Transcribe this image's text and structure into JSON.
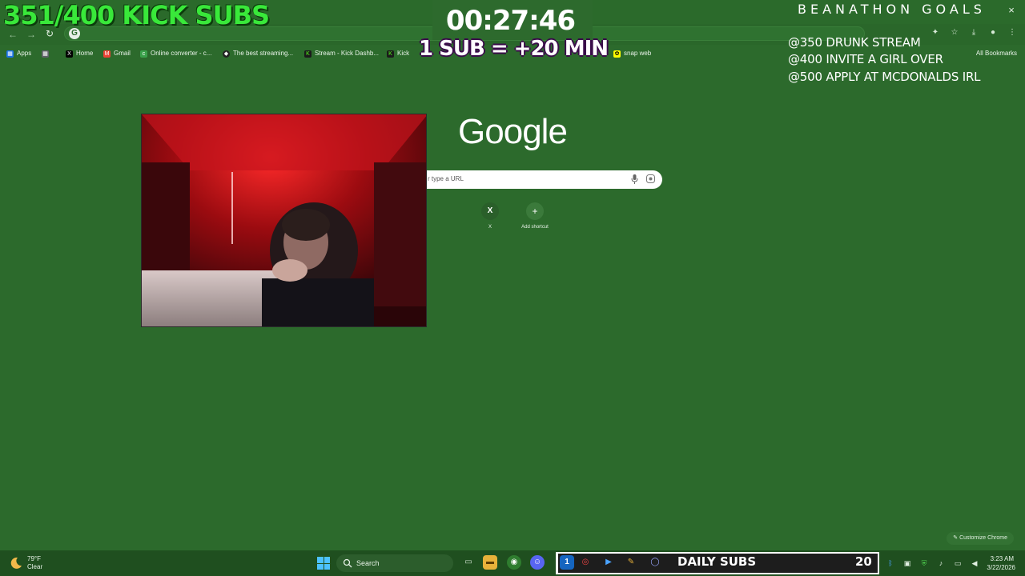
{
  "browser": {
    "close_glyph": "×",
    "omnibox_glyph": "G",
    "back_glyph": "←",
    "forward_glyph": "→",
    "reload_glyph": "↻",
    "toolbar_icons": [
      "extensions-icon",
      "star-icon",
      "download-icon",
      "profile-icon",
      "menu-icon"
    ],
    "bookmarks": [
      {
        "label": "Apps",
        "icon": "apps-grid-icon",
        "color": "#1a73e8"
      },
      {
        "label": "",
        "icon": "grid-icon",
        "color": "#5f6368"
      },
      {
        "label": "Home",
        "icon": "x-logo-icon",
        "color": "#000000"
      },
      {
        "label": "Gmail",
        "icon": "gmail-icon",
        "color": "#ea4335"
      },
      {
        "label": "Online converter - c...",
        "icon": "converter-icon",
        "color": "#3aa14a"
      },
      {
        "label": "The best streaming...",
        "icon": "streaming-icon",
        "color": "#222222"
      },
      {
        "label": "Stream - Kick Dashb...",
        "icon": "kick-icon",
        "color": "#53fc18"
      },
      {
        "label": "Kick",
        "icon": "kick-icon",
        "color": "#53fc18"
      },
      {
        "label": "snap web",
        "icon": "snapchat-icon",
        "color": "#fffc00"
      }
    ],
    "all_bookmarks": "All Bookmarks"
  },
  "ntp": {
    "logo": "Google",
    "search_placeholder": "r type a URL",
    "shortcuts": [
      {
        "label": "X",
        "glyph": "X"
      },
      {
        "label": "Add shortcut",
        "glyph": "+"
      }
    ],
    "customize": "Customize Chrome"
  },
  "overlay": {
    "subs_count": "351/400 KICK SUBS",
    "timer": "00:27:46",
    "sub_rule": "1 SUB = +20 MIN",
    "goals_title": "BEANATHON GOALS",
    "goals": [
      "@350 DRUNK  STREAM",
      "@400 INVITE A GIRL OVER",
      "@500 APPLY AT MCDONALDS IRL"
    ]
  },
  "taskbar": {
    "weather_temp": "79°F",
    "weather_desc": "Clear",
    "search_label": "Search",
    "daily_subs_label": "DAILY SUBS",
    "daily_subs_count": "20",
    "time": "3:23 AM",
    "date": "3/22/2026",
    "colors": {
      "accent": "#4cc2ff"
    }
  },
  "colors": {
    "background": "#2c6a2c",
    "subs_green": "#39e83a"
  }
}
